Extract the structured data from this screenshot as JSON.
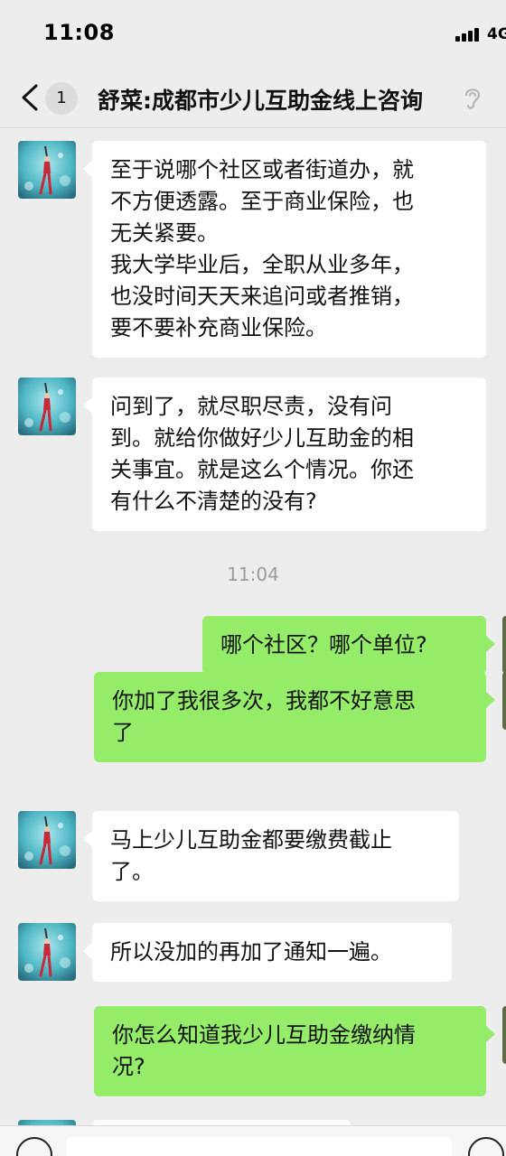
{
  "status_bar": {
    "time": "11:08",
    "network": "4G"
  },
  "nav": {
    "unread_count": "1",
    "title": "舒菜:成都市少儿互助金线上咨询"
  },
  "messages": [
    {
      "dir": "in",
      "text": "至于说哪个社区或者街道办，就\n不方便透露。至于商业保险，也\n无关紧要。\n我大学毕业后，全职从业多年，\n也没时间天天来追问或者推销，\n要不要补充商业保险。"
    },
    {
      "dir": "in",
      "text": "问到了，就尽职尽责，没有问\n到。就给你做好少儿互助金的相\n关事宜。就是这么个情况。你还\n有什么不清楚的没有?"
    },
    {
      "dir": "time",
      "text": "11:04"
    },
    {
      "dir": "out",
      "text": "哪个社区？哪个单位?"
    },
    {
      "dir": "out",
      "text": "你加了我很多次，我都不好意思\n了"
    },
    {
      "dir": "in",
      "text": "马上少儿互助金都要缴费截止\n了。"
    },
    {
      "dir": "in",
      "text": "所以没加的再加了通知一遍。"
    },
    {
      "dir": "out",
      "text": "你怎么知道我少儿互助金缴纳情\n况?"
    }
  ]
}
